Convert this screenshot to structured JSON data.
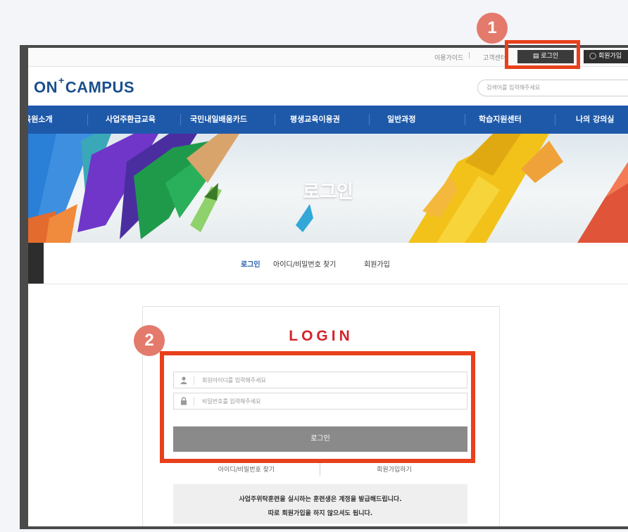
{
  "utility": {
    "guide": "이용가이드",
    "separator": "|",
    "customer_center": "고객센터",
    "login": "로그인",
    "join": "회원가입"
  },
  "header": {
    "logo_left": "ON",
    "logo_plus": "+",
    "logo_right": "CAMPUS",
    "search_placeholder": "검색어를 입력해주세요"
  },
  "nav": {
    "items": [
      {
        "label": "교육원소개"
      },
      {
        "label": "사업주환급교육"
      },
      {
        "label": "국민내일배움카드"
      },
      {
        "label": "평생교육이용권"
      },
      {
        "label": "일반과정"
      },
      {
        "label": "학습지원센터"
      },
      {
        "label": "나의 강의실"
      }
    ]
  },
  "banner": {
    "title": "로그인"
  },
  "subtabs": [
    {
      "label": "로그인"
    },
    {
      "label": "아이디/비밀번호 찾기"
    },
    {
      "label": "회원가입"
    }
  ],
  "login": {
    "heading": "LOGIN",
    "id_placeholder": "회원아이디를 입력해주세요",
    "pw_placeholder": "비밀번호를 입력해주세요",
    "submit": "로그인",
    "find_link": "아이디/비밀번호 찾기",
    "join_link": "회원가입하기",
    "notice_line1": "사업주위탁훈련을 실시하는 훈련생은 계정을 발급해드립니다.",
    "notice_line2": "따로 회원가입을 하지 않으셔도 됩니다."
  },
  "badges": {
    "one": "1",
    "two": "2"
  },
  "colors": {
    "nav": "#1e59a9",
    "highlight": "#e8401c",
    "badge": "#e37a6c",
    "login_heading": "#d6232c"
  }
}
